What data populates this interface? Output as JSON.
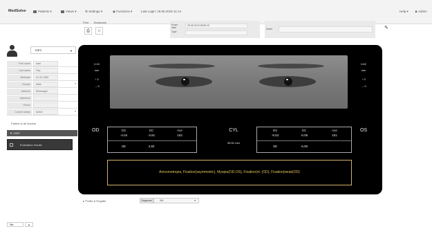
{
  "topnav": {
    "logo": "MedSolve",
    "items": [
      "Patients",
      "Views",
      "Settings",
      "Functions"
    ],
    "last_login": "Last Login: 19.05.2019 11:14",
    "right_items": [
      "Help",
      "Admin"
    ]
  },
  "sidebar": {
    "patient_name": "Irani",
    "fields": [
      {
        "label": "First name",
        "value": "Irani"
      },
      {
        "label": "Last name",
        "value": "Hey"
      },
      {
        "label": "Birthdate",
        "value": "01.02.1983"
      },
      {
        "label": "Gender",
        "value": "Male",
        "dropdown": true
      },
      {
        "label": "Address",
        "value": "Kilimangel"
      },
      {
        "label": "Address2",
        "value": ""
      },
      {
        "label": "Phone",
        "value": ""
      },
      {
        "label": "Current status",
        "value": "Active",
        "dropdown": true
      }
    ],
    "add_link": "Patient to all doctors",
    "visit_tab": "VISIT",
    "visit_item": "Evaluation results"
  },
  "toolbar": {
    "print_label": "Print",
    "bookmark_label": "Bookmark",
    "print_icon": "print-icon",
    "star_icon": "star-icon"
  },
  "meta": {
    "date_label": "Exam date",
    "date_value": "26.06.2019 08:56:10",
    "type_label": "Type",
    "type_value": "",
    "notes_label": "Notes",
    "notes_value": ""
  },
  "panel": {
    "left_side": {
      "top": "0.19",
      "unit": "mm",
      "arrow1": "0",
      "arrow2": "0"
    },
    "right_side": {
      "top": "0.82",
      "unit": "mm",
      "arrow1": "0",
      "arrow2": "0"
    },
    "od": {
      "label": "OD",
      "headers": [
        "DS",
        "DC",
        "Axe"
      ],
      "values": [
        "-4.04",
        "-3.81",
        "163"
      ],
      "se_label": "SE",
      "se_value": "4.50"
    },
    "os": {
      "label": "OS",
      "headers": [
        "DS",
        "DC",
        "Axe"
      ],
      "values": [
        "-5.53",
        "-0.05",
        "151"
      ],
      "se_label": "SE",
      "se_value": "-5.90"
    },
    "cyl": {
      "label": "CYL",
      "value": "55.51 mm"
    },
    "diagnosis": "Anisometropia, Fixation(asymmetric), Myopia(OD,OS), Fixation(nt. (OD), Fixation(weak(OD)"
  },
  "bottom": {
    "label": "Profile & Rogatte",
    "segment_label": "Diagnosis",
    "select_value": "001"
  },
  "footer": {
    "a": "Title",
    "b": "▲"
  },
  "colors": {
    "panel_bg": "#000000",
    "diagnosis_text": "#e6c45a",
    "diagnosis_border": "#d4b46c"
  }
}
